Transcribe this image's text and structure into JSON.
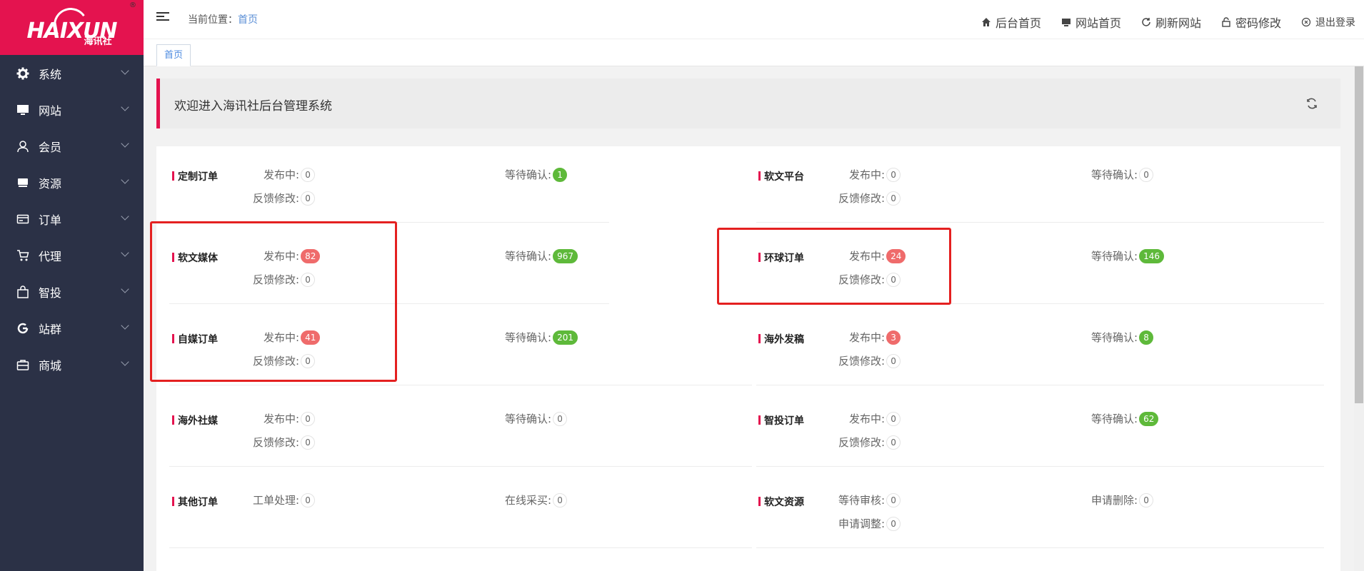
{
  "logo": {
    "word": "HAIXUN",
    "cn": "海讯社",
    "reg": "®"
  },
  "colors": {
    "brand": "#e4134f",
    "sidebar": "#2b3146",
    "badge_red": "#ef6b6b",
    "badge_green": "#5eb93a",
    "link": "#4d8be0"
  },
  "sidebar": {
    "items": [
      {
        "label": "系统",
        "icon": "gear-icon"
      },
      {
        "label": "网站",
        "icon": "monitor-icon"
      },
      {
        "label": "会员",
        "icon": "user-icon"
      },
      {
        "label": "资源",
        "icon": "stack-icon"
      },
      {
        "label": "订单",
        "icon": "card-icon"
      },
      {
        "label": "代理",
        "icon": "cart-icon"
      },
      {
        "label": "智投",
        "icon": "bag-icon"
      },
      {
        "label": "站群",
        "icon": "refresh-c-icon"
      },
      {
        "label": "商城",
        "icon": "briefcase-icon"
      }
    ]
  },
  "header": {
    "crumb_label": "当前位置：",
    "crumb_current": "首页",
    "links": [
      {
        "label": "后台首页",
        "icon": "home-icon"
      },
      {
        "label": "网站首页",
        "icon": "monitor-icon"
      },
      {
        "label": "刷新网站",
        "icon": "refresh-icon"
      },
      {
        "label": "密码修改",
        "icon": "lock-icon"
      },
      {
        "label": "退出登录",
        "icon": "close-circle-icon"
      }
    ]
  },
  "tabs": [
    {
      "label": "首页"
    }
  ],
  "welcome": {
    "text": "欢迎进入海讯社后台管理系统"
  },
  "sections": {
    "dingzhi": {
      "title": "定制订单",
      "a_label": "发布中:",
      "a_val": "0",
      "b_label": "等待确认:",
      "b_val": "1",
      "c_label": "反馈修改:",
      "c_val": "0"
    },
    "ruanwen_platform": {
      "title": "软文平台",
      "a_label": "发布中:",
      "a_val": "0",
      "b_label": "等待确认:",
      "b_val": "0",
      "c_label": "反馈修改:",
      "c_val": "0"
    },
    "ruanwen_media": {
      "title": "软文媒体",
      "a_label": "发布中:",
      "a_val": "82",
      "b_label": "等待确认:",
      "b_val": "967",
      "c_label": "反馈修改:",
      "c_val": "0"
    },
    "huanqiu": {
      "title": "环球订单",
      "a_label": "发布中:",
      "a_val": "24",
      "b_label": "等待确认:",
      "b_val": "146",
      "c_label": "反馈修改:",
      "c_val": "0"
    },
    "zimei": {
      "title": "自媒订单",
      "a_label": "发布中:",
      "a_val": "41",
      "b_label": "等待确认:",
      "b_val": "201",
      "c_label": "反馈修改:",
      "c_val": "0"
    },
    "haiwai_fagao": {
      "title": "海外发稿",
      "a_label": "发布中:",
      "a_val": "3",
      "b_label": "等待确认:",
      "b_val": "8",
      "c_label": "反馈修改:",
      "c_val": "0"
    },
    "haiwai_shemei": {
      "title": "海外社媒",
      "a_label": "发布中:",
      "a_val": "0",
      "b_label": "等待确认:",
      "b_val": "0",
      "c_label": "反馈修改:",
      "c_val": "0"
    },
    "zhitou": {
      "title": "智投订单",
      "a_label": "发布中:",
      "a_val": "0",
      "b_label": "等待确认:",
      "b_val": "62",
      "c_label": "反馈修改:",
      "c_val": "0"
    },
    "qita": {
      "title": "其他订单",
      "a_label": "工单处理:",
      "a_val": "0",
      "b_label": "在线采买:",
      "b_val": "0"
    },
    "ruanwen_res": {
      "title": "软文资源",
      "a_label": "等待审核:",
      "a_val": "0",
      "b_label": "申请删除:",
      "b_val": "0",
      "c_label": "申请调整:",
      "c_val": "0"
    }
  }
}
